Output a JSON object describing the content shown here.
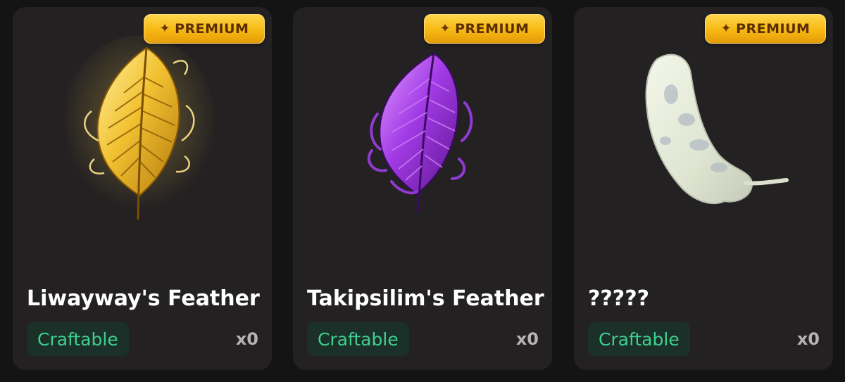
{
  "cards": [
    {
      "badge": {
        "icon": "sparkle-icon",
        "label": "PREMIUM"
      },
      "image": "golden-feather",
      "name": "Liwayway's Feather",
      "status": "Craftable",
      "count": "x0"
    },
    {
      "badge": {
        "icon": "sparkle-icon",
        "label": "PREMIUM"
      },
      "image": "purple-feather",
      "name": "Takipsilim's Feather",
      "status": "Craftable",
      "count": "x0"
    },
    {
      "badge": {
        "icon": "sparkle-icon",
        "label": "PREMIUM"
      },
      "image": "unknown-white-feather",
      "name": "?????",
      "status": "Craftable",
      "count": "x0"
    }
  ],
  "colors": {
    "background": "#151415",
    "card": "#242122",
    "badge": "#f6b813",
    "craftable_text": "#3fd08e",
    "craftable_bg": "#1c302a",
    "count_text": "#b7b2b3"
  }
}
